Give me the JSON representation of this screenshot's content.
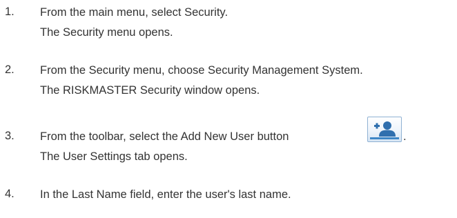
{
  "steps": [
    {
      "number": "1.",
      "instruction": "From the main menu, select Security.",
      "result": "The Security menu opens."
    },
    {
      "number": "2.",
      "instruction": "From the Security menu, choose Security Management System.",
      "result": "The RISKMASTER Security window opens."
    },
    {
      "number": "3.",
      "instruction": "From the toolbar, select the Add New User button",
      "instruction_suffix": ".",
      "result": "The User Settings tab opens.",
      "icon": "add-user-icon"
    },
    {
      "number": "4.",
      "instruction": "In the Last Name field, enter the user's last name."
    }
  ],
  "colors": {
    "text": "#333333",
    "icon_blue": "#2f6fae",
    "icon_border": "#8fb1d3"
  }
}
